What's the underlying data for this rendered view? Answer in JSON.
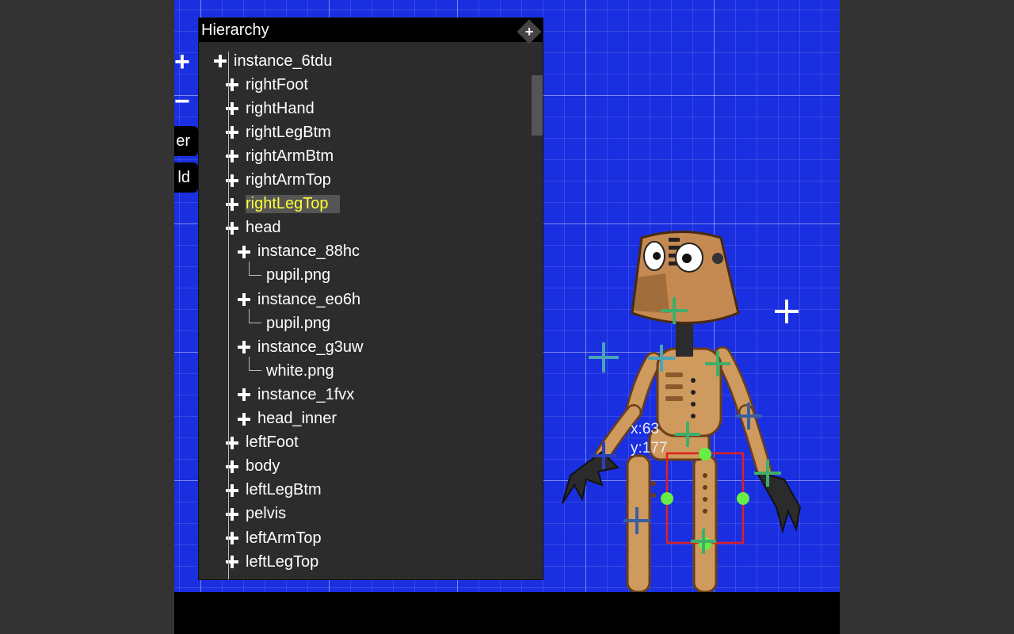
{
  "panel": {
    "title": "Hierarchy",
    "close_icon": "close-icon"
  },
  "side_buttons": {
    "zoom_in_label": "+",
    "zoom_out_label": "−",
    "button_1_label": "er",
    "button_2_label": "ld"
  },
  "tree": [
    {
      "label": "instance_6tdu",
      "depth": 0,
      "expander": true
    },
    {
      "label": "rightFoot",
      "depth": 1,
      "expander": true
    },
    {
      "label": "rightHand",
      "depth": 1,
      "expander": true
    },
    {
      "label": "rightLegBtm",
      "depth": 1,
      "expander": true
    },
    {
      "label": "rightArmBtm",
      "depth": 1,
      "expander": true
    },
    {
      "label": "rightArmTop",
      "depth": 1,
      "expander": true
    },
    {
      "label": "rightLegTop",
      "depth": 1,
      "expander": true,
      "selected": true
    },
    {
      "label": "head",
      "depth": 1,
      "expander": true
    },
    {
      "label": "instance_88hc",
      "depth": 2,
      "expander": true
    },
    {
      "label": "pupil.png",
      "depth": 3,
      "expander": false
    },
    {
      "label": "instance_eo6h",
      "depth": 2,
      "expander": true
    },
    {
      "label": "pupil.png",
      "depth": 3,
      "expander": false
    },
    {
      "label": "instance_g3uw",
      "depth": 2,
      "expander": true
    },
    {
      "label": "white.png",
      "depth": 3,
      "expander": false
    },
    {
      "label": "instance_1fvx",
      "depth": 2,
      "expander": true
    },
    {
      "label": "head_inner",
      "depth": 2,
      "expander": true
    },
    {
      "label": "leftFoot",
      "depth": 1,
      "expander": true
    },
    {
      "label": "body",
      "depth": 1,
      "expander": true
    },
    {
      "label": "leftLegBtm",
      "depth": 1,
      "expander": true
    },
    {
      "label": "pelvis",
      "depth": 1,
      "expander": true
    },
    {
      "label": "leftArmTop",
      "depth": 1,
      "expander": true
    },
    {
      "label": "leftLegTop",
      "depth": 1,
      "expander": true
    }
  ],
  "canvas": {
    "coord_x": "x:63",
    "coord_y": "y:177",
    "selection_color": "#e02020",
    "handle_color": "#66ee44",
    "bone_marker_color": "#3fae6a",
    "grid_color": "#1a2fe0"
  }
}
